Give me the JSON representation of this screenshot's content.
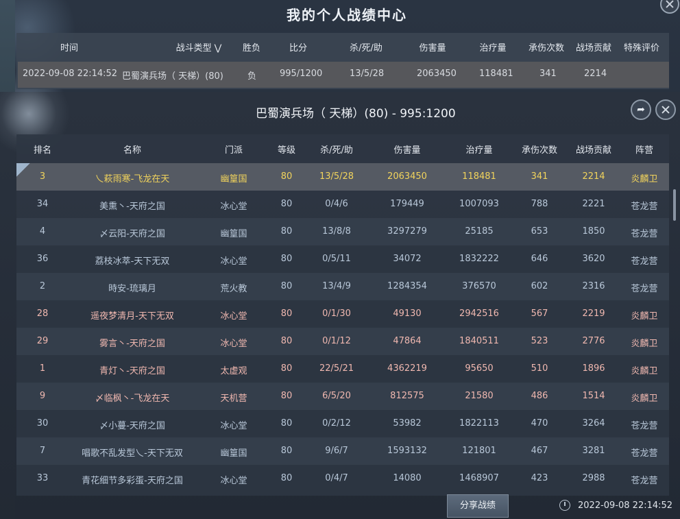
{
  "window": {
    "title": "我的个人战绩中心"
  },
  "record_list": {
    "headers": [
      "时间",
      "战斗类型",
      "胜负",
      "比分",
      "杀/死/助",
      "伤害量",
      "治疗量",
      "承伤次数",
      "战场贡献",
      "特殊评价"
    ],
    "rows": [
      {
        "time": "2022-09-08 22:14:52",
        "type": "巴蜀演兵场（ 天梯）(80)",
        "result": "负",
        "score": "995/1200",
        "kda": "13/5/28",
        "damage": "2063450",
        "healing": "118481",
        "hits_taken": "341",
        "contribution": "2214",
        "special": ""
      }
    ]
  },
  "detail": {
    "title": "巴蜀演兵场（ 天梯）(80) - 995:1200",
    "headers": [
      "排名",
      "名称",
      "门派",
      "等级",
      "杀/死/助",
      "伤害量",
      "治疗量",
      "承伤次数",
      "战场贡献",
      "阵营"
    ],
    "rows": [
      {
        "rank": "3",
        "name": "乀萩雨寒-飞龙在天",
        "school": "幽篁国",
        "level": "80",
        "kda": "13/5/28",
        "damage": "2063450",
        "healing": "118481",
        "hits": "341",
        "contribution": "2214",
        "camp": "炎麟卫"
      },
      {
        "rank": "34",
        "name": "美熏丶-天府之国",
        "school": "冰心堂",
        "level": "80",
        "kda": "0/4/6",
        "damage": "179449",
        "healing": "1007093",
        "hits": "788",
        "contribution": "2221",
        "camp": "苍龙营"
      },
      {
        "rank": "4",
        "name": "〆云阳-天府之国",
        "school": "幽篁国",
        "level": "80",
        "kda": "13/8/8",
        "damage": "3297279",
        "healing": "25185",
        "hits": "653",
        "contribution": "1850",
        "camp": "苍龙营"
      },
      {
        "rank": "36",
        "name": "荔枝冰萃-天下无双",
        "school": "冰心堂",
        "level": "80",
        "kda": "0/5/11",
        "damage": "34072",
        "healing": "1832222",
        "hits": "646",
        "contribution": "3620",
        "camp": "苍龙营"
      },
      {
        "rank": "2",
        "name": "時安-琉璃月",
        "school": "荒火教",
        "level": "80",
        "kda": "13/4/9",
        "damage": "1284354",
        "healing": "376570",
        "hits": "602",
        "contribution": "2316",
        "camp": "苍龙营"
      },
      {
        "rank": "28",
        "name": "遥夜梦清月-天下无双",
        "school": "冰心堂",
        "level": "80",
        "kda": "0/1/30",
        "damage": "49130",
        "healing": "2942516",
        "hits": "567",
        "contribution": "2219",
        "camp": "炎麟卫"
      },
      {
        "rank": "29",
        "name": "雾言丶-天府之国",
        "school": "冰心堂",
        "level": "80",
        "kda": "0/1/12",
        "damage": "47864",
        "healing": "1840511",
        "hits": "523",
        "contribution": "2776",
        "camp": "炎麟卫"
      },
      {
        "rank": "1",
        "name": "青灯丶-天府之国",
        "school": "太虚观",
        "level": "80",
        "kda": "22/5/21",
        "damage": "4362219",
        "healing": "95650",
        "hits": "510",
        "contribution": "1896",
        "camp": "炎麟卫"
      },
      {
        "rank": "9",
        "name": "〆临枫丶-飞龙在天",
        "school": "天机营",
        "level": "80",
        "kda": "6/5/20",
        "damage": "812575",
        "healing": "21580",
        "hits": "486",
        "contribution": "1514",
        "camp": "炎麟卫"
      },
      {
        "rank": "30",
        "name": "〆小蔓-天府之国",
        "school": "冰心堂",
        "level": "80",
        "kda": "0/2/12",
        "damage": "53982",
        "healing": "1822113",
        "hits": "470",
        "contribution": "3264",
        "camp": "苍龙营"
      },
      {
        "rank": "7",
        "name": "唱歌不乱发型乀-天下无双",
        "school": "幽篁国",
        "level": "80",
        "kda": "9/6/7",
        "damage": "1593132",
        "healing": "121801",
        "hits": "467",
        "contribution": "3281",
        "camp": "苍龙营"
      },
      {
        "rank": "33",
        "name": "青花细节多彩蛋-天府之国",
        "school": "冰心堂",
        "level": "80",
        "kda": "0/4/7",
        "damage": "14080",
        "healing": "1468907",
        "hits": "423",
        "contribution": "2988",
        "camp": "苍龙营"
      }
    ]
  },
  "footer": {
    "share_label": "分享战绩",
    "time": "2022-09-08  22:14:52"
  },
  "colors": {
    "self_row": "#f2d45c",
    "blue_camp_text": "#b9c8d9",
    "red_camp_text": "#f0b8b0"
  },
  "icons": {
    "filter": "chevron-down-icon",
    "share": "share-arrow-icon",
    "close": "close-icon",
    "clock": "clock-icon"
  }
}
